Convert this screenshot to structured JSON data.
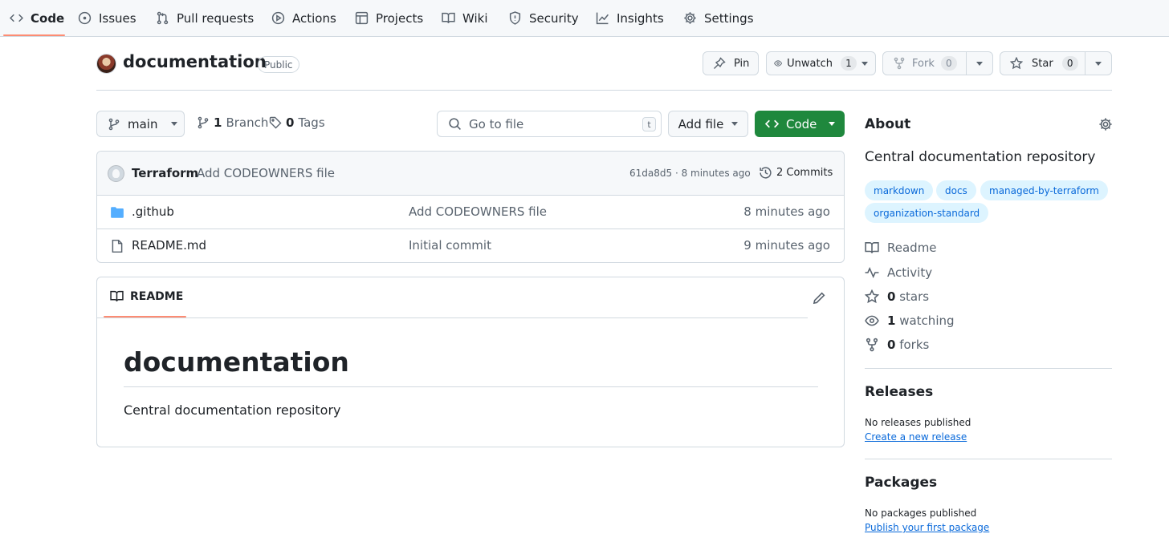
{
  "nav": {
    "tabs": [
      {
        "label": "Code",
        "icon": "code-icon"
      },
      {
        "label": "Issues",
        "icon": "issue-icon"
      },
      {
        "label": "Pull requests",
        "icon": "pull-request-icon"
      },
      {
        "label": "Actions",
        "icon": "play-icon"
      },
      {
        "label": "Projects",
        "icon": "table-icon"
      },
      {
        "label": "Wiki",
        "icon": "book-icon"
      },
      {
        "label": "Security",
        "icon": "shield-icon"
      },
      {
        "label": "Insights",
        "icon": "graph-icon"
      },
      {
        "label": "Settings",
        "icon": "gear-icon"
      }
    ],
    "active": "Code"
  },
  "repo": {
    "name": "documentation",
    "visibility": "Public",
    "pin_label": "Pin",
    "watch_label": "Unwatch",
    "watch_count": "1",
    "fork_label": "Fork",
    "fork_count": "0",
    "star_label": "Star",
    "star_count": "0"
  },
  "toolbar": {
    "branch": "main",
    "branch_count": "1",
    "branch_label": "Branch",
    "tag_count": "0",
    "tag_label": "Tags",
    "search_placeholder": "Go to file",
    "search_shortcut": "t",
    "add_file_label": "Add file",
    "code_label": "Code"
  },
  "commit": {
    "author": "Terraform",
    "message": "Add CODEOWNERS file",
    "meta": "61da8d5 · 8 minutes ago",
    "commits_label": "2 Commits"
  },
  "files": [
    {
      "type": "folder",
      "name": ".github",
      "commit": "Add CODEOWNERS file",
      "time": "8 minutes ago"
    },
    {
      "type": "file",
      "name": "README.md",
      "commit": "Initial commit",
      "time": "9 minutes ago"
    }
  ],
  "readme": {
    "tab_label": "README",
    "heading": "documentation",
    "body": "Central documentation repository"
  },
  "about": {
    "title": "About",
    "description": "Central documentation repository",
    "topics": [
      "markdown",
      "docs",
      "managed-by-terraform",
      "organization-standard"
    ],
    "links": {
      "readme": "Readme",
      "activity": "Activity",
      "stars_count": "0",
      "stars_label": "stars",
      "watching_count": "1",
      "watching_label": "watching",
      "forks_count": "0",
      "forks_label": "forks"
    }
  },
  "releases": {
    "title": "Releases",
    "empty": "No releases published",
    "cta": "Create a new release"
  },
  "packages": {
    "title": "Packages",
    "empty": "No packages published",
    "cta": "Publish your first package"
  },
  "colors": {
    "accent_green": "#1f883d",
    "link_blue": "#0969da",
    "tab_underline": "#fd8c73",
    "topic_bg": "#ddf4ff"
  }
}
